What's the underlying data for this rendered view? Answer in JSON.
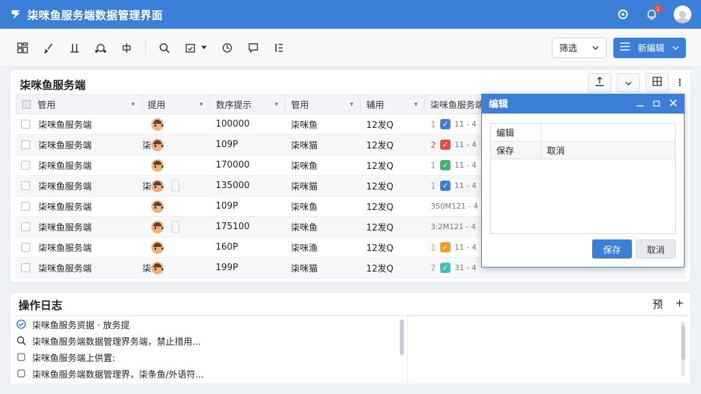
{
  "app": {
    "title": "柒咪鱼服务端数据管理界面",
    "notification_count": "1"
  },
  "toolbar": {
    "filter_label": "筛选",
    "new_label": "新编辑"
  },
  "panel": {
    "title": "柒咪鱼服务端",
    "headers": [
      "管用",
      "提用",
      "数序提示",
      "管用",
      "辅用",
      "柒咪鱼服务端"
    ],
    "rows": [
      {
        "name": "柒咪鱼服务端",
        "pre": "",
        "side": false,
        "id": "100000",
        "kind": "柒咪鱼",
        "time": "12发Q",
        "num": "1",
        "numColor": "#999",
        "chkColor": "#3b7fd9",
        "tail": "11 - 4"
      },
      {
        "name": "柒咪鱼服务端",
        "pre": "柒",
        "side": false,
        "id": "109P",
        "kind": "柒咪猫",
        "time": "12发Q",
        "num": "2",
        "numColor": "#e84a3c",
        "chkColor": "#e84a3c",
        "tail": "11 - 4"
      },
      {
        "name": "柒咪鱼服务端",
        "pre": "",
        "side": false,
        "id": "170000",
        "kind": "柒咪鱼",
        "time": "12发Q",
        "num": "1",
        "numColor": "#999",
        "chkColor": "#3db36b",
        "tail": "11 - 4"
      },
      {
        "name": "柒咪鱼服务端",
        "pre": "柒",
        "side": true,
        "id": "135000",
        "kind": "柒咪猫",
        "time": "12发Q",
        "num": "1",
        "numColor": "#999",
        "chkColor": "#3b7fd9",
        "tail": "11 - 4"
      },
      {
        "name": "柒咪鱼服务端",
        "pre": "",
        "side": false,
        "id": "109P",
        "kind": "柒咪鱼",
        "time": "12发Q",
        "num": "",
        "numColor": "#999",
        "chkColor": "",
        "tail": "350M121 - 4"
      },
      {
        "name": "柒咪鱼服务端",
        "pre": "",
        "side": true,
        "id": "175100",
        "kind": "柒咪鱼",
        "time": "12发Q",
        "num": "",
        "numColor": "#999",
        "chkColor": "",
        "tail": "3:2M121 - 4"
      },
      {
        "name": "柒咪鱼服务端",
        "pre": "",
        "side": false,
        "id": "160P",
        "kind": "柒咪渔",
        "time": "12发Q",
        "num": "1",
        "numColor": "#f0a020",
        "chkColor": "#f0a020",
        "tail": "11 - 4"
      },
      {
        "name": "柒咪鱼服务端",
        "pre": "柒",
        "side": false,
        "id": "199P",
        "kind": "柒咪猫",
        "time": "12发Q",
        "num": "7",
        "numColor": "#999",
        "chkColor": "#3fc0c0",
        "tail": "31 - 4"
      }
    ]
  },
  "dialog": {
    "title": "编辑",
    "row1_label": "编辑",
    "row2_label": "保存",
    "row2_value": "取消",
    "save_label": "保存",
    "cancel_label": "取消"
  },
  "log": {
    "title": "操作日志",
    "right_label": "预",
    "items": [
      {
        "icon": "check-circle-icon",
        "text": "柒咪鱼服务资据 · 放务提"
      },
      {
        "icon": "search-icon",
        "text": "柒咪鱼服务端数据管理界务端，禁止措用..."
      },
      {
        "icon": "checkbox-icon",
        "text": "柒咪鱼服务端上供置:"
      },
      {
        "icon": "checkbox-icon",
        "text": "柒咪鱼服务端数据管理界，柒条鱼/外语符..."
      }
    ]
  }
}
